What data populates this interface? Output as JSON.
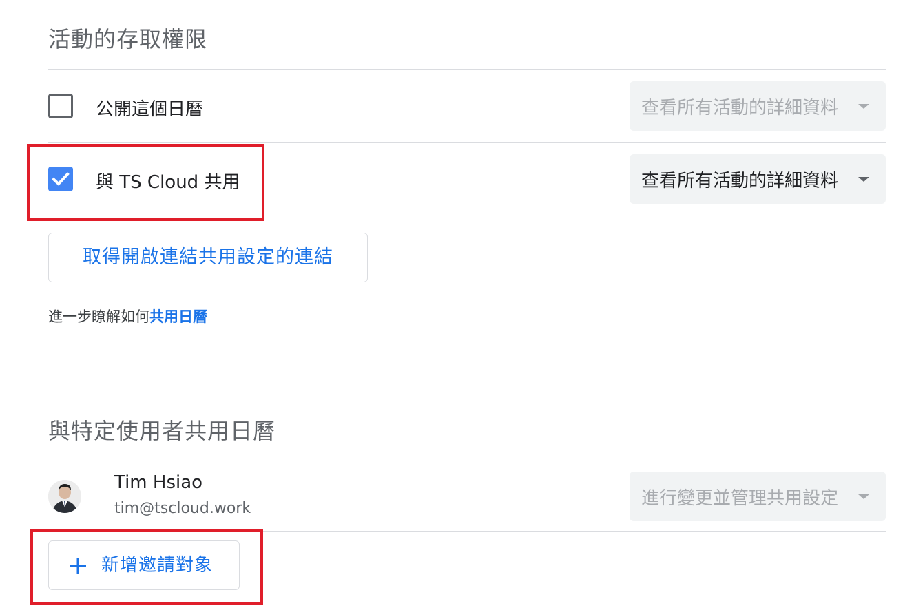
{
  "event_access": {
    "title": "活動的存取權限",
    "public_calendar": {
      "label": "公開這個日曆",
      "checked": false,
      "permission": "查看所有活動的詳細資料",
      "permission_disabled": true
    },
    "share_with_org": {
      "label": "與 TS Cloud 共用",
      "checked": true,
      "permission": "查看所有活動的詳細資料",
      "permission_disabled": false
    },
    "get_link_button": "取得開啟連結共用設定的連結",
    "help_prefix": "進一步瞭解如何",
    "help_link": "共用日曆"
  },
  "specific_people": {
    "title": "與特定使用者共用日曆",
    "users": [
      {
        "name": "Tim Hsiao",
        "email": "tim@tscloud.work",
        "permission": "進行變更並管理共用設定",
        "permission_disabled": true
      }
    ],
    "add_people_button": "新增邀請對象"
  },
  "colors": {
    "accent": "#1a73e8",
    "checkbox_checked": "#4285f4",
    "highlight": "#e01e2a",
    "divider": "#dadce0",
    "select_bg": "#f1f3f4"
  }
}
